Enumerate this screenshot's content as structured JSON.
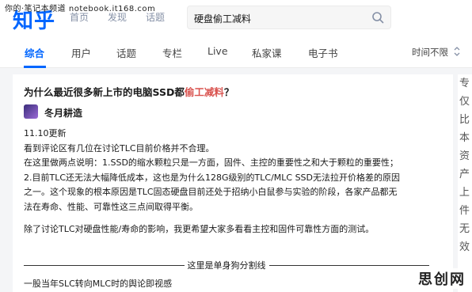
{
  "watermark_top": "你的·笔记本频道 notebook.it168.com",
  "logo": "知乎",
  "topnav": [
    "首页",
    "发现",
    "话题"
  ],
  "search": {
    "value": "硬盘偷工减料"
  },
  "tabs": [
    "综合",
    "用户",
    "话题",
    "专栏",
    "Live",
    "私家课",
    "电子书"
  ],
  "time_filter": "时间不限",
  "article": {
    "title_prefix": "为什么最近很多新上市的电脑SSD都",
    "title_highlight": "偷工减料",
    "title_suffix": "？",
    "author": "冬月耕造",
    "lines": [
      "11.10更新",
      "看到评论区有几位在讨论TLC目前价格并不合理。",
      "在这里做两点说明：1.SSD的缩水颗粒只是一方面，固件、主控的重要性之和大于颗粒的重要性；",
      "2.目前TLC还无法大幅降低成本，这也是为什么128G级别的TLC/MLC SSD无法拉开价格差的原因",
      "之一。这个现象的根本原因是TLC固态硬盘目前还处于招纳小白鼠参与实验的阶段，各家产品都无",
      "法在寿命、性能、可靠性这三点间取得平衡。"
    ],
    "paragraph2": "除了讨论TLC对硬盘性能/寿命的影响，我更希望大家多看看主控和固件可靠性方面的测试。",
    "divider_text": "这里是单身狗分割线",
    "last_line": "一股当年SLC转向MLC时的舆论即视感"
  },
  "right_strip": [
    "专",
    "仅",
    "比",
    "本",
    "资",
    "产",
    "上",
    "件",
    "无",
    "效"
  ],
  "watermark_br": "思创网",
  "colors": {
    "accent": "#0066ff",
    "highlight": "#d9534f"
  }
}
